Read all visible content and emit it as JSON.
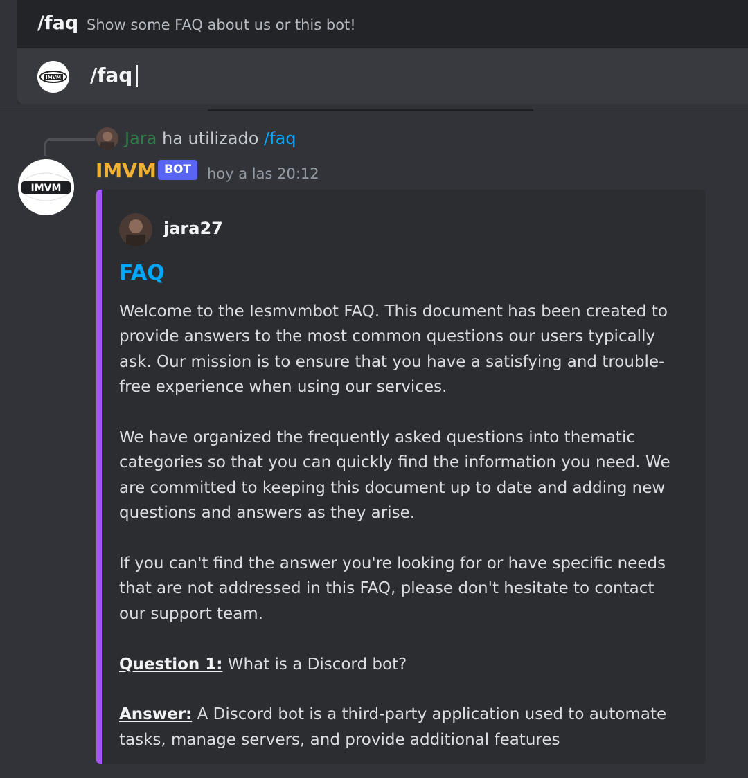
{
  "autocomplete": {
    "command": "/faq",
    "description": "Show some FAQ about us or this bot!"
  },
  "input": {
    "value": "/faq"
  },
  "reply": {
    "username": "Jara",
    "action": "ha utilizado",
    "command": "/faq"
  },
  "message": {
    "author": "IMVM",
    "badge": "BOT",
    "timestamp": "hoy a las 20:12",
    "embed": {
      "accent_color": "#a855f7",
      "author_name": "jara27",
      "title": "FAQ",
      "paragraphs": [
        "Welcome to the Iesmvmbot FAQ. This document has been created to provide answers to the most common questions our users typically ask. Our mission is to ensure that you have a satisfying and trouble-free experience when using our services.",
        "We have organized the frequently asked questions into thematic categories so that you can quickly find the information you need. We are committed to keeping this document up to date and adding new questions and answers as they arise.",
        "If you can't find the answer you're looking for or have specific needs that are not addressed in this FAQ, please don't hesitate to contact our support team."
      ],
      "question_label": "Question 1:",
      "question_text": "What is a Discord bot?",
      "answer_label": "Answer:",
      "answer_text": "A Discord bot is a third-party application used to automate tasks, manage servers, and provide additional features"
    }
  },
  "colors": {
    "background": "#313338",
    "bot_name": "#f0b132",
    "link": "#00a8fc",
    "badge": "#5865f2",
    "reply_user": "#2d7d46"
  },
  "icons": {
    "bot_avatar": "imvm-logo-avatar",
    "user_avatar": "user-photo-avatar"
  }
}
